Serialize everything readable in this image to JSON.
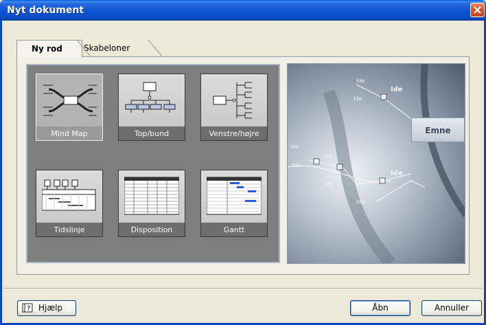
{
  "window": {
    "title": "Nyt dokument"
  },
  "tabs": [
    {
      "label": "Ny rod",
      "active": true
    },
    {
      "label": "Skabeloner",
      "active": false
    }
  ],
  "templates": [
    {
      "label": "Mind Map",
      "icon": "mind-map-icon",
      "selected": true
    },
    {
      "label": "Top/bund",
      "icon": "org-chart-icon",
      "selected": false
    },
    {
      "label": "Venstre/højre",
      "icon": "tree-diagram-icon",
      "selected": false
    },
    {
      "label": "Tidslinje",
      "icon": "timeline-icon",
      "selected": false
    },
    {
      "label": "Disposition",
      "icon": "outline-table-icon",
      "selected": false
    },
    {
      "label": "Gantt",
      "icon": "gantt-chart-icon",
      "selected": false
    }
  ],
  "preview": {
    "central_topic": "Emne",
    "idea_label": "Ide"
  },
  "buttons": {
    "help": "Hjælp",
    "open": "Åbn",
    "cancel": "Annuller"
  },
  "colors": {
    "titlebar": "#0a4cc6",
    "dialog_bg": "#ece9d8",
    "selected_tile": "#9a9a9a"
  }
}
